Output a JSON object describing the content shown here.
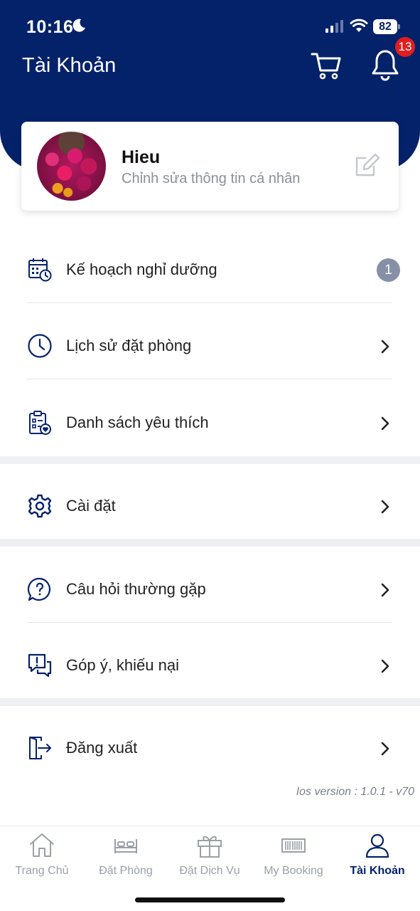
{
  "status_bar": {
    "time": "10:16",
    "battery": "82"
  },
  "header": {
    "title": "Tài Khoản",
    "notification_count": "13"
  },
  "profile": {
    "name": "Hieu",
    "subtitle": "Chỉnh sửa thông tin cá nhân"
  },
  "menu": {
    "vacation_plan": {
      "label": "Kế hoạch nghỉ dưỡng",
      "count": "1"
    },
    "booking_history": {
      "label": "Lịch sử đặt phòng"
    },
    "wishlist": {
      "label": "Danh sách yêu thích"
    },
    "settings": {
      "label": "Cài đặt"
    },
    "faq": {
      "label": "Câu hỏi thường gặp"
    },
    "feedback": {
      "label": "Góp ý, khiếu nại"
    },
    "logout": {
      "label": "Đăng xuất"
    }
  },
  "version": "Ios version : 1.0.1 - v70",
  "tabs": [
    {
      "label": "Trang Chủ",
      "icon": "home-icon",
      "active": false
    },
    {
      "label": "Đặt Phòng",
      "icon": "bed-icon",
      "active": false
    },
    {
      "label": "Đặt Dịch Vụ",
      "icon": "gift-icon",
      "active": false
    },
    {
      "label": "My Booking",
      "icon": "barcode-icon",
      "active": false
    },
    {
      "label": "Tài Khoản",
      "icon": "user-icon",
      "active": true
    }
  ],
  "colors": {
    "brand": "#04226a",
    "badge_red": "#e01e1e",
    "badge_gray": "#8590a6"
  }
}
